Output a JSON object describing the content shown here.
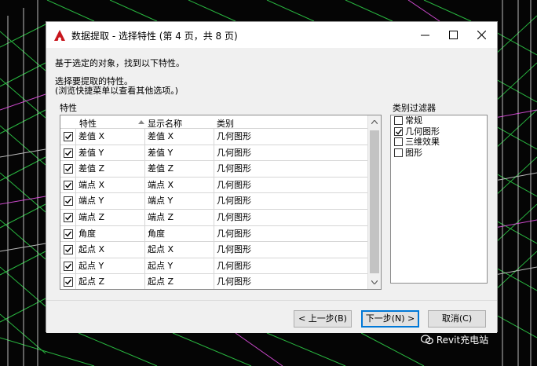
{
  "dialog": {
    "title": "数据提取 - 选择特性 (第 4 页，共 8 页)",
    "intro_text": "基于选定的对象，找到以下特性。",
    "instruction_line1": "选择要提取的特性。",
    "instruction_line2": "(浏览快捷菜单以查看其他选项。)"
  },
  "properties_grid": {
    "group_label": "特性",
    "headers": [
      "特性",
      "显示名称",
      "类别"
    ],
    "rows": [
      {
        "checked": true,
        "property": "差值 X",
        "display_name": "差值 X",
        "category": "几何图形"
      },
      {
        "checked": true,
        "property": "差值 Y",
        "display_name": "差值 Y",
        "category": "几何图形"
      },
      {
        "checked": true,
        "property": "差值 Z",
        "display_name": "差值 Z",
        "category": "几何图形"
      },
      {
        "checked": true,
        "property": "端点 X",
        "display_name": "端点 X",
        "category": "几何图形"
      },
      {
        "checked": true,
        "property": "端点 Y",
        "display_name": "端点 Y",
        "category": "几何图形"
      },
      {
        "checked": true,
        "property": "端点 Z",
        "display_name": "端点 Z",
        "category": "几何图形"
      },
      {
        "checked": true,
        "property": "角度",
        "display_name": "角度",
        "category": "几何图形"
      },
      {
        "checked": true,
        "property": "起点 X",
        "display_name": "起点 X",
        "category": "几何图形"
      },
      {
        "checked": true,
        "property": "起点 Y",
        "display_name": "起点 Y",
        "category": "几何图形"
      },
      {
        "checked": true,
        "property": "起点 Z",
        "display_name": "起点 Z",
        "category": "几何图形"
      }
    ]
  },
  "category_filter": {
    "group_label": "类别过滤器",
    "items": [
      {
        "label": "常规",
        "checked": false
      },
      {
        "label": "几何图形",
        "checked": true
      },
      {
        "label": "三维效果",
        "checked": false
      },
      {
        "label": "图形",
        "checked": false
      }
    ]
  },
  "buttons": {
    "back": "< 上一步(B)",
    "next": "下一步(N) >",
    "cancel": "取消(C)"
  },
  "watermark": "Revit充电站",
  "colors": {
    "app_icon": "#c8161d",
    "default_button_border": "#0078d7",
    "grid_lines": "#3cff5a"
  }
}
